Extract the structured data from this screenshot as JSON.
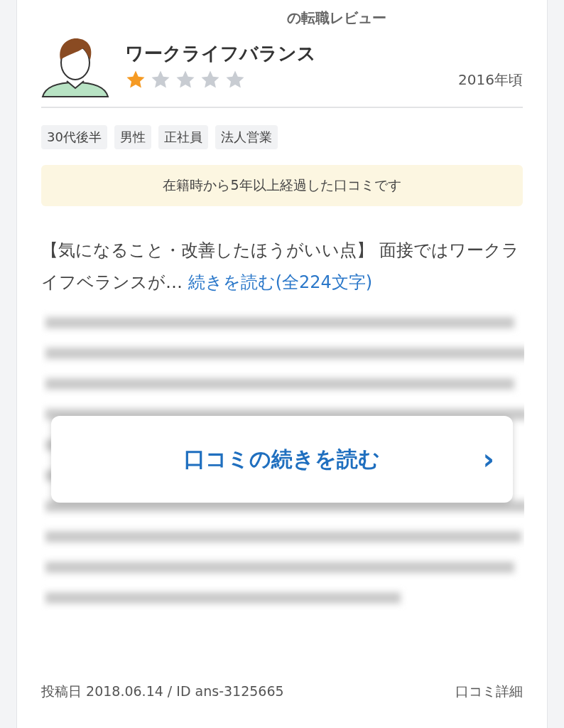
{
  "header": {
    "title": "の転職レビュー"
  },
  "review": {
    "title": "ワークライフバランス",
    "stars": 1,
    "period": "2016年頃"
  },
  "tags": [
    "30代後半",
    "男性",
    "正社員",
    "法人営業"
  ],
  "notice": "在籍時から5年以上経過した口コミです",
  "excerpt": {
    "text": "【気になること・改善したほうがいい点】 面接ではワークライフベランスが…",
    "link": "続きを読む(全224文字)"
  },
  "read_more_button": {
    "label": "口コミの続きを読む",
    "icon": "›"
  },
  "footer": {
    "meta": "投稿日 2018.06.14 / ID ans-3125665",
    "detail_link": "口コミ詳細"
  }
}
